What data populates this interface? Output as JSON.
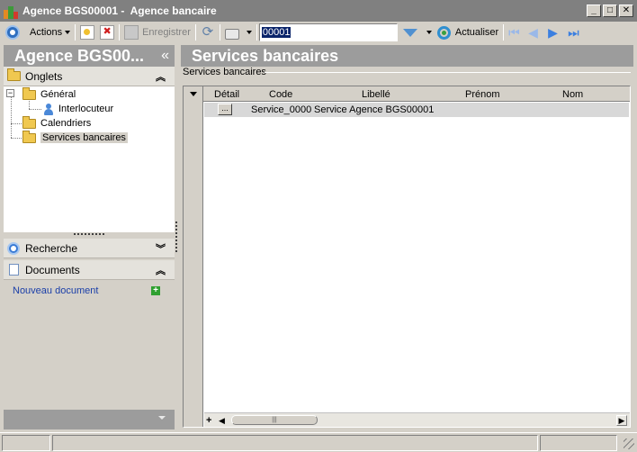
{
  "window": {
    "title": "Agence BGS00001 -  Agence bancaire",
    "buttons": {
      "minimize": "_",
      "maximize": "□",
      "close": "✕"
    }
  },
  "toolbar": {
    "actions_label": "Actions",
    "save_label": "Enregistrer",
    "search_value": "00001",
    "actualiser_label": "Actualiser"
  },
  "left_panel": {
    "header": "Agence BGS00...",
    "collapse_glyph": "«",
    "onglets_label": "Onglets",
    "tree": {
      "general": "Général",
      "interlocuteur": "Interlocuteur",
      "calendriers": "Calendriers",
      "services_bancaires": "Services bancaires"
    },
    "recherche_label": "Recherche",
    "documents_label": "Documents",
    "new_document_label": "Nouveau document"
  },
  "main": {
    "header": "Services bancaires",
    "group_label": "Services bancaires",
    "grid": {
      "columns": [
        "Détail",
        "Code",
        "Libellé",
        "Prénom",
        "Nom"
      ],
      "rows": [
        {
          "detail": "...",
          "code": "Service_0000",
          "libelle": "Service Agence BGS00001",
          "prenom": "",
          "nom": ""
        }
      ]
    }
  },
  "icons": {
    "app": "app-logo-icon",
    "actions": "target-icon",
    "new": "new-document-icon",
    "delete": "delete-icon",
    "save": "save-icon",
    "refresh": "refresh-icon",
    "print": "print-icon",
    "filter": "filter-icon",
    "actualiser": "actualiser-icon",
    "first": "first-record-icon",
    "prev": "previous-record-icon",
    "next": "next-record-icon",
    "last": "last-record-icon"
  }
}
